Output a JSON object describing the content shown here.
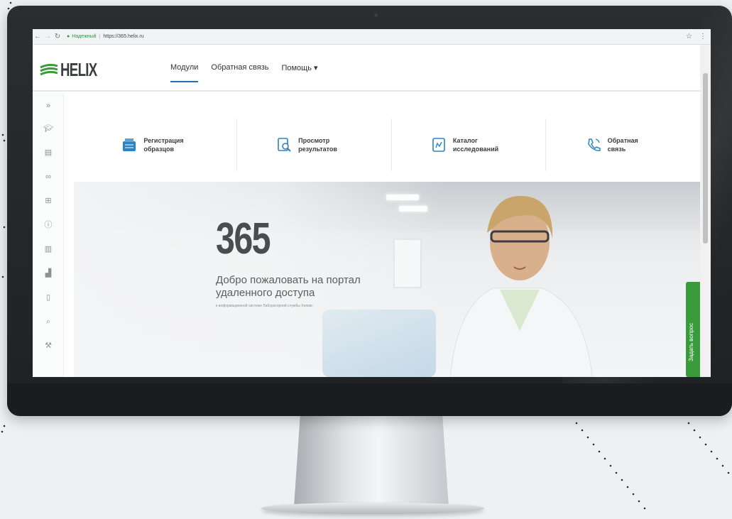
{
  "browser": {
    "secure_label": "Надежный",
    "url": "https://365.helix.ru"
  },
  "brand": {
    "name": "HELIX",
    "accent": "#2b6fae",
    "green": "#3a9b3c"
  },
  "topnav": [
    {
      "label": "Модули",
      "active": true
    },
    {
      "label": "Обратная связь"
    },
    {
      "label": "Помощь ▾"
    }
  ],
  "sidebar_icons": [
    "collapse-icon",
    "graduation-cap-icon",
    "list-icon",
    "link-icon",
    "plus-box-icon",
    "info-icon",
    "barcode-icon",
    "chart-icon",
    "document-icon",
    "search-icon",
    "wrench-icon"
  ],
  "modules": [
    {
      "line1": "Регистрация",
      "line2": "образцов",
      "icon": "registration-icon"
    },
    {
      "line1": "Просмотр",
      "line2": "результатов",
      "icon": "results-icon"
    },
    {
      "line1": "Каталог",
      "line2": "исследований",
      "icon": "catalog-icon"
    },
    {
      "line1": "Обратная",
      "line2": "связь",
      "icon": "phone-icon"
    }
  ],
  "hero": {
    "number": "365",
    "line1": "Добро пожаловать на портал",
    "line2": "удаленного доступа",
    "subtitle": "к информационной системе Лабораторной службы Хеликс"
  },
  "ask_button": "Задать вопрос"
}
